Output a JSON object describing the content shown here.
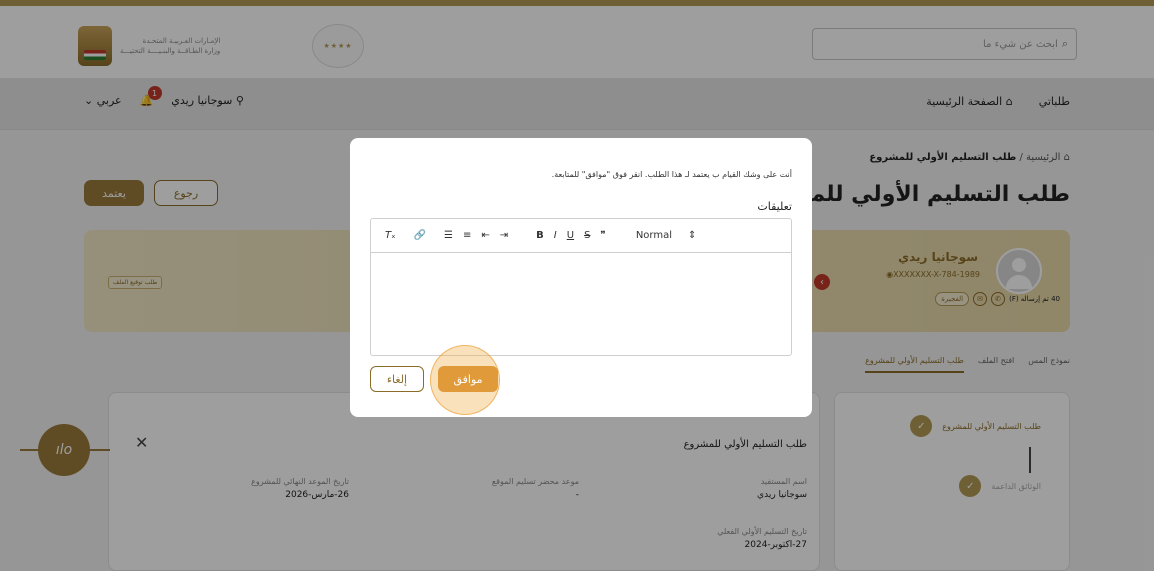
{
  "header": {
    "ministry_line1": "الإمـارات العـربيـة المتحـدة",
    "ministry_line2": "وزارة الطـاقــة والبنـيــــة التحتيـــة",
    "search_placeholder": "ابحث عن شيء ما"
  },
  "nav": {
    "home": "الصفحة الرئيسية",
    "my_requests": "طلباتي",
    "user_name": "سوجانيا ريدي",
    "notifications_count": "1",
    "language": "عربي"
  },
  "page": {
    "breadcrumb_home": "الرئيسية",
    "breadcrumb_sep": "/",
    "breadcrumb_current": "طلب التسليم الأولي للمشروع",
    "title": "طلب التسليم الأولي للمشرو",
    "approve_label": "يعتمد",
    "back_label": "رجوع"
  },
  "profile": {
    "name": "سوجانيا ريدي",
    "id": "XXXXXXX-X-784-1989",
    "sent_text": "40 تم إرساله (F)",
    "emirate": "الفجيرة",
    "request_chip": "طلب توقيع الملف"
  },
  "tabs": [
    "طلب التسليم الأولي للمشروع",
    "افتح الملف",
    "نموذج المس"
  ],
  "steps": [
    {
      "label": "طلب التسليم الأولي للمشروع"
    },
    {
      "label": "الوثائق الداعمة"
    }
  ],
  "details": {
    "title": "طلب التسليم الأولي للمشروع",
    "beneficiary_label": "اسم المستفيد",
    "beneficiary_value": "سوجانيا ريدي",
    "site_handover_label": "موعد محضر تسليم الموقع",
    "site_handover_value": "-",
    "deadline_label": "تاريخ الموعد النهائي للمشروع",
    "deadline_value": "26-مارس-2026",
    "actual_handover_label": "تاريخ التسليم الأولي الفعلي",
    "actual_handover_value": "27-اكتوبر-2024"
  },
  "modal": {
    "message": "أنت على وشك القيام ب يعتمد لـ هذا الطلب. انقر فوق \"موافق\" للمتابعة.",
    "comments_label": "تعليقات",
    "format_select": "Normal",
    "ok_label": "موافق",
    "cancel_label": "إلغاء"
  }
}
